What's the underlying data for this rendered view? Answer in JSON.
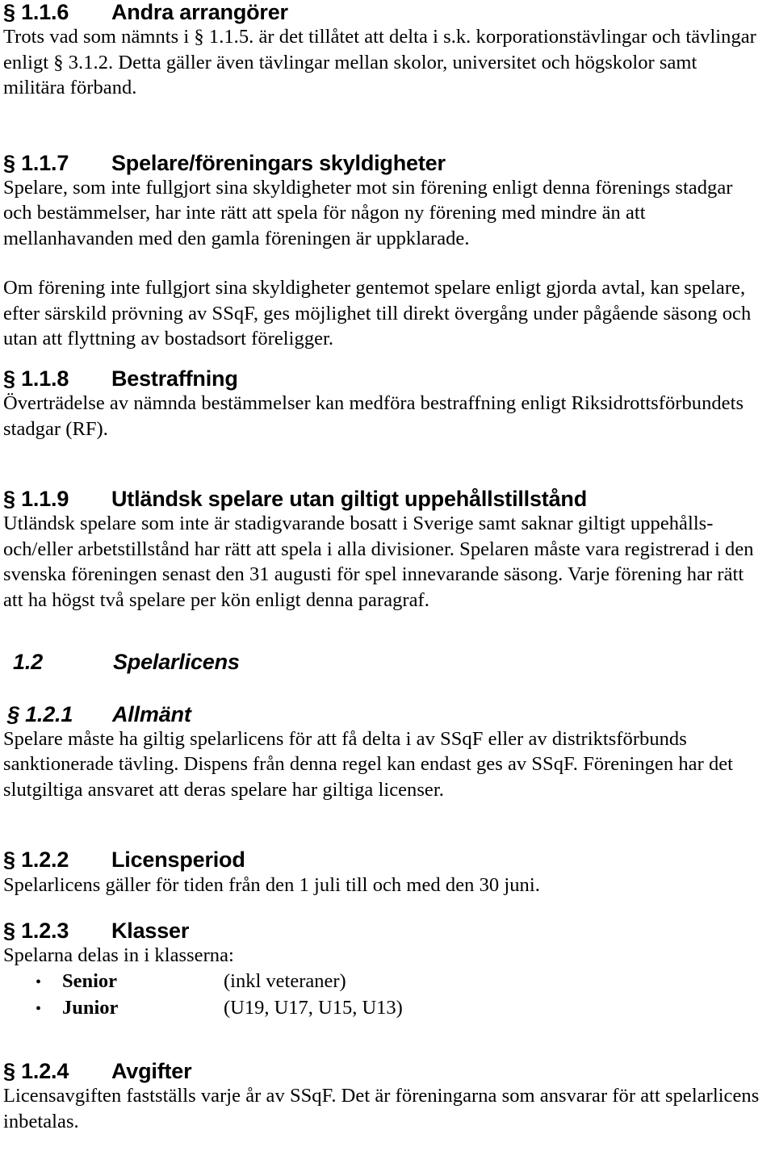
{
  "document": {
    "language": "sv",
    "sections": [
      {
        "id": "1.1.6",
        "number": "§ 1.1.6",
        "title": "Andra arrangörer",
        "style": "upright",
        "body": "Trots vad som nämnts i § 1.1.5. är det tillåtet att delta i s.k. korporationstävlingar och tävlingar enligt § 3.1.2. Detta gäller även tävlingar mellan skolor, universitet och högskolor samt militära förband."
      },
      {
        "id": "1.1.7",
        "number": "§ 1.1.7",
        "title": "Spelare/föreningars skyldigheter",
        "style": "upright",
        "body": "Spelare, som inte fullgjort sina skyldigheter mot sin förening enligt denna förenings stadgar och bestämmelser, har inte rätt att spela för någon ny förening med mindre än att mellanhavanden med den gamla föreningen är uppklarade.",
        "body2": "Om förening inte fullgjort sina skyldigheter gentemot spelare enligt gjorda avtal, kan spelare, efter särskild prövning av SSqF, ges möjlighet till direkt övergång under pågående säsong och utan att flyttning av bostadsort föreligger."
      },
      {
        "id": "1.1.8",
        "number": "§ 1.1.8",
        "title": "Bestraffning",
        "style": "upright",
        "body": "Överträdelse av nämnda bestämmelser kan medföra bestraffning enligt Riksidrottsförbundets stadgar (RF)."
      },
      {
        "id": "1.1.9",
        "number": "§ 1.1.9",
        "title": "Utländsk spelare utan giltigt uppehållstillstånd",
        "style": "upright",
        "body": "Utländsk spelare som inte är stadigvarande bosatt i Sverige samt saknar giltigt uppehålls- och/eller arbetstillstånd har rätt att spela i alla divisioner. Spelaren måste vara registrerad i den svenska föreningen senast den 31 augusti för spel innevarande säsong. Varje förening har rätt att ha högst två spelare per kön enligt denna paragraf."
      },
      {
        "id": "1.2",
        "number": "1.2",
        "title": "Spelarlicens",
        "style": "italic",
        "body": ""
      },
      {
        "id": "1.2.1",
        "number": "§ 1.2.1",
        "title": "Allmänt",
        "style": "italic",
        "body": "Spelare måste ha giltig spelarlicens för att få delta i av SSqF eller av distriktsförbunds sanktionerade tävling. Dispens från denna regel kan endast ges av SSqF. Föreningen har det slutgiltiga ansvaret att deras spelare har giltiga licenser."
      },
      {
        "id": "1.2.2",
        "number": "§ 1.2.2",
        "title": "Licensperiod",
        "style": "upright",
        "body": "Spelarlicens gäller för tiden från den 1 juli till och med den 30 juni."
      },
      {
        "id": "1.2.3",
        "number": "§ 1.2.3",
        "title": "Klasser",
        "style": "upright",
        "body": "Spelarna delas in i klasserna:",
        "list": [
          {
            "bullet": "•",
            "term": "Senior",
            "detail": "(inkl veteraner)"
          },
          {
            "bullet": "•",
            "term": "Junior",
            "detail": "(U19, U17, U15, U13)"
          }
        ]
      },
      {
        "id": "1.2.4",
        "number": "§ 1.2.4",
        "title": "Avgifter",
        "style": "upright",
        "body": "Licensavgiften fastställs varje år av SSqF. Det är föreningarna som ansvarar för att spelarlicens inbetalas."
      }
    ]
  }
}
